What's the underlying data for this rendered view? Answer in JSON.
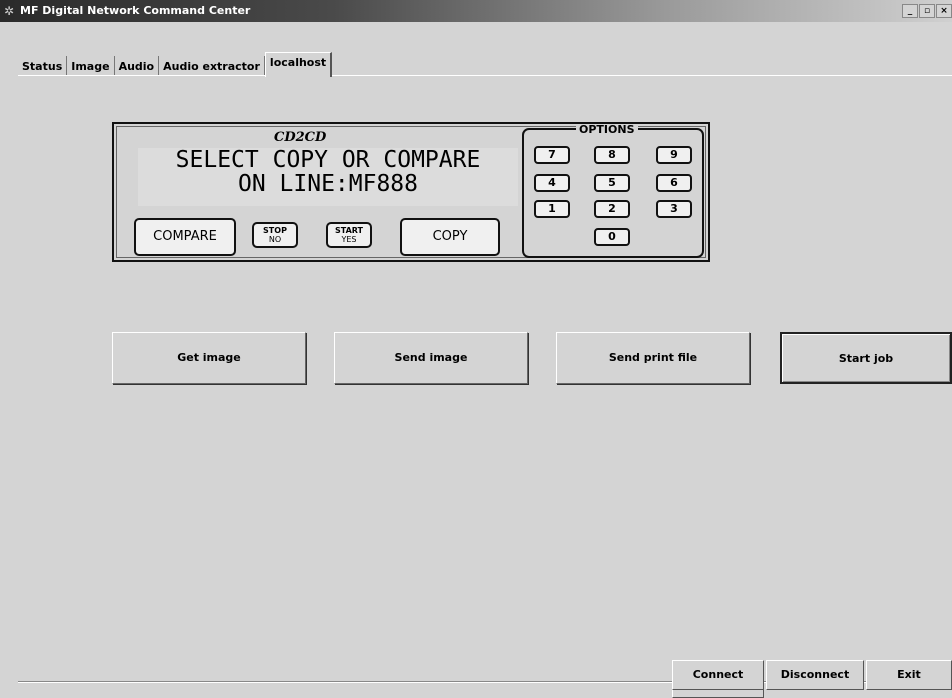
{
  "window": {
    "title": "MF Digital Network Command Center",
    "controls": [
      "_",
      "▫",
      "×"
    ]
  },
  "tabs": [
    {
      "label": "Status"
    },
    {
      "label": "Image"
    },
    {
      "label": "Audio"
    },
    {
      "label": "Audio extractor"
    },
    {
      "label": "localhost",
      "active": true
    }
  ],
  "device": {
    "logo": "CD2CD",
    "lcd_line1": "SELECT COPY OR COMPARE",
    "lcd_line2": "ON LINE:MF888",
    "compare_label": "COMPARE",
    "stop_label": "STOP",
    "stop_sub": "NO",
    "start_label": "START",
    "start_sub": "YES",
    "copy_label": "COPY",
    "options_title": "OPTIONS",
    "keys": [
      "7",
      "8",
      "9",
      "4",
      "5",
      "6",
      "1",
      "2",
      "3",
      "0"
    ]
  },
  "actions": {
    "get_image": "Get image",
    "send_image": "Send image",
    "send_print_file": "Send print file",
    "start_job": "Start job"
  },
  "footer": {
    "connect": "Connect",
    "disconnect": "Disconnect",
    "exit": "Exit"
  }
}
